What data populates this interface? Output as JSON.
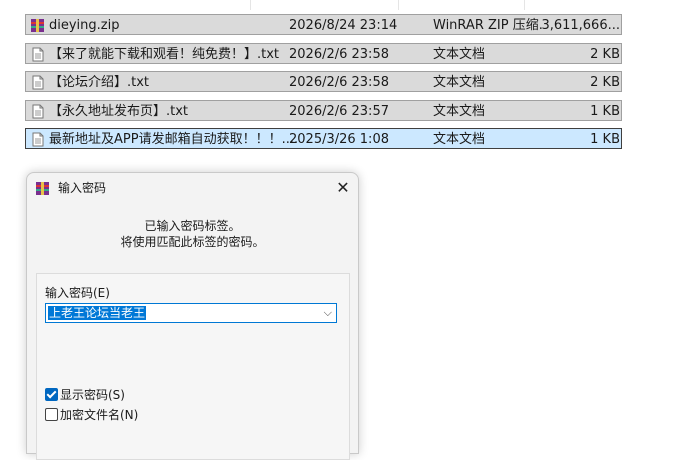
{
  "files": [
    {
      "name": "dieying.zip",
      "date": "2026/8/24 23:14",
      "type": "WinRAR ZIP 压缩...",
      "size": "3,611,666...",
      "icon": "winrar-archive-icon",
      "selected": false
    },
    {
      "name": "【来了就能下载和观看！纯免费！】.txt",
      "date": "2026/2/6 23:58",
      "type": "文本文档",
      "size": "2 KB",
      "icon": "text-file-icon",
      "selected": false
    },
    {
      "name": "【论坛介绍】.txt",
      "date": "2026/2/6 23:58",
      "type": "文本文档",
      "size": "2 KB",
      "icon": "text-file-icon",
      "selected": false
    },
    {
      "name": "【永久地址发布页】.txt",
      "date": "2026/2/6 23:57",
      "type": "文本文档",
      "size": "1 KB",
      "icon": "text-file-icon",
      "selected": false
    },
    {
      "name": "最新地址及APP请发邮箱自动获取！！！....",
      "date": "2025/3/26 1:08",
      "type": "文本文档",
      "size": "1 KB",
      "icon": "text-file-icon",
      "selected": true
    }
  ],
  "dialog": {
    "title": "输入密码",
    "message_line1": "已输入密码标签。",
    "message_line2": "将使用匹配此标签的密码。",
    "password_label": "输入密码(E)",
    "password_value": "上老王论坛当老王",
    "show_password_label": "显示密码(S)",
    "show_password_checked": true,
    "encrypt_filenames_label": "加密文件名(N)",
    "encrypt_filenames_checked": false
  },
  "colors": {
    "row_bg": "#dadada",
    "selected_bg": "#cce8ff",
    "accent": "#0078d4"
  }
}
